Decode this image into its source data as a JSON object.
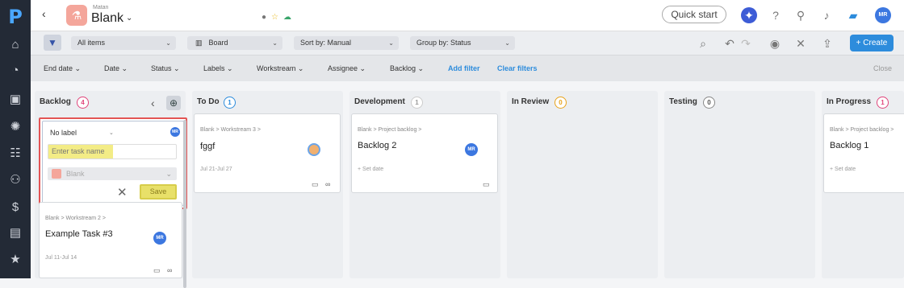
{
  "sidebar": {
    "icons": [
      "logo-p",
      "home-icon",
      "dashboard-icon",
      "briefcase-icon",
      "lightbulb-icon",
      "board-icon",
      "team-icon",
      "money-bag-icon",
      "clipboard-icon",
      "star-icon"
    ]
  },
  "header": {
    "workspace": "Matan",
    "project": "Blank",
    "quick_start": "Quick start",
    "user_initials": "MR"
  },
  "toolbar": {
    "items_filter": "All items",
    "view": "Board",
    "sort": "Sort by: Manual",
    "group": "Group by: Status",
    "create": "+ Create"
  },
  "filters": {
    "items": [
      "End date",
      "Date",
      "Status",
      "Labels",
      "Workstream",
      "Assignee",
      "Backlog"
    ],
    "add_filter": "Add filter",
    "clear_filters": "Clear filters",
    "close": "Close"
  },
  "form": {
    "label": "No label",
    "placeholder": "Enter task name",
    "project": "Blank",
    "save": "Save",
    "avatar": "MR"
  },
  "columns": [
    {
      "title": "Backlog",
      "count": "4",
      "color": "#e0457b"
    },
    {
      "title": "To Do",
      "count": "1",
      "color": "#2d8cdc"
    },
    {
      "title": "Development",
      "count": "1",
      "color": "#999999"
    },
    {
      "title": "In Review",
      "count": "0",
      "color": "#e8a31c"
    },
    {
      "title": "Testing",
      "count": "0",
      "color": "#555555"
    },
    {
      "title": "In Progress",
      "count": "1",
      "color": "#e0457b"
    }
  ],
  "cards": {
    "backlog_card": {
      "crumb": "Blank > Workstream 2 >",
      "title": "Example Task #3",
      "date": "Jul 11-Jul 14",
      "avatar": "MR"
    },
    "todo_card": {
      "crumb": "Blank > Workstream 3 >",
      "title": "fggf",
      "date": "Jul 21-Jul 27"
    },
    "dev_card": {
      "crumb": "Blank > Project backlog >",
      "title": "Backlog 2",
      "date": "+ Set date",
      "avatar": "MR"
    },
    "progress_card": {
      "crumb": "Blank > Project backlog >",
      "title": "Backlog 1",
      "date": "+ Set date"
    }
  }
}
